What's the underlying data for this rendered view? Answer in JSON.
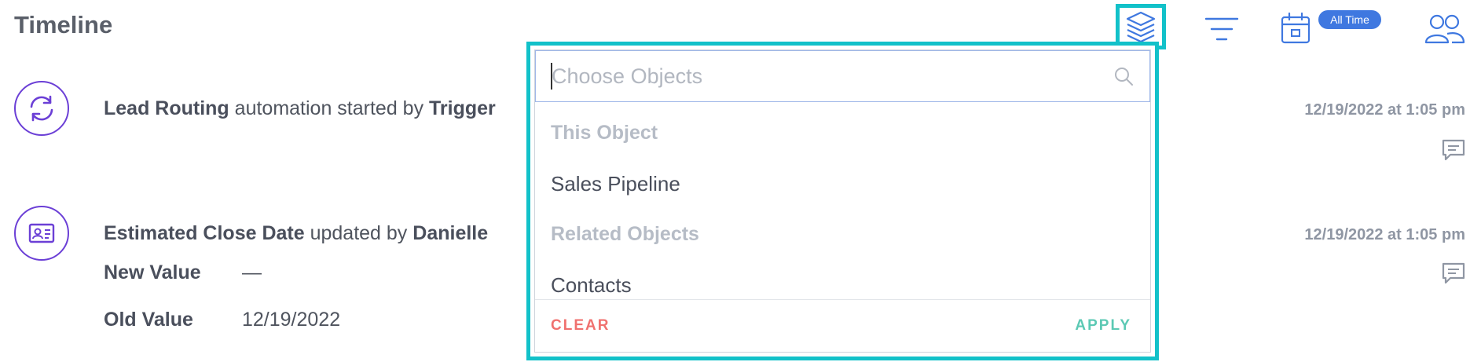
{
  "header": {
    "title": "Timeline",
    "date_badge": "All Time",
    "icons": [
      "layers-icon",
      "filter-icon",
      "calendar-icon",
      "users-icon"
    ]
  },
  "timeline": [
    {
      "icon": "sync-icon",
      "subject": "Lead Routing",
      "action": " automation started by ",
      "actor": "Trigger",
      "time": "12/19/2022 at 1:05 pm"
    },
    {
      "icon": "id-card-icon",
      "subject": "Estimated Close Date",
      "action": " updated by ",
      "actor": "Danielle",
      "time": "12/19/2022 at 1:05 pm",
      "new_label": "New Value",
      "new_value": "—",
      "old_label": "Old Value",
      "old_value": "12/19/2022"
    }
  ],
  "dropdown": {
    "placeholder": "Choose Objects",
    "group_this": "This Object",
    "item_sales": "Sales Pipeline",
    "group_related": "Related Objects",
    "item_contacts": "Contacts",
    "clear": "CLEAR",
    "apply": "APPLY"
  },
  "colors": {
    "accent_teal": "#12c1c9",
    "icon_blue": "#3f78e0",
    "icon_purple": "#6b3fd6",
    "clear_red": "#f0716f",
    "apply_green": "#5cc9b4"
  }
}
